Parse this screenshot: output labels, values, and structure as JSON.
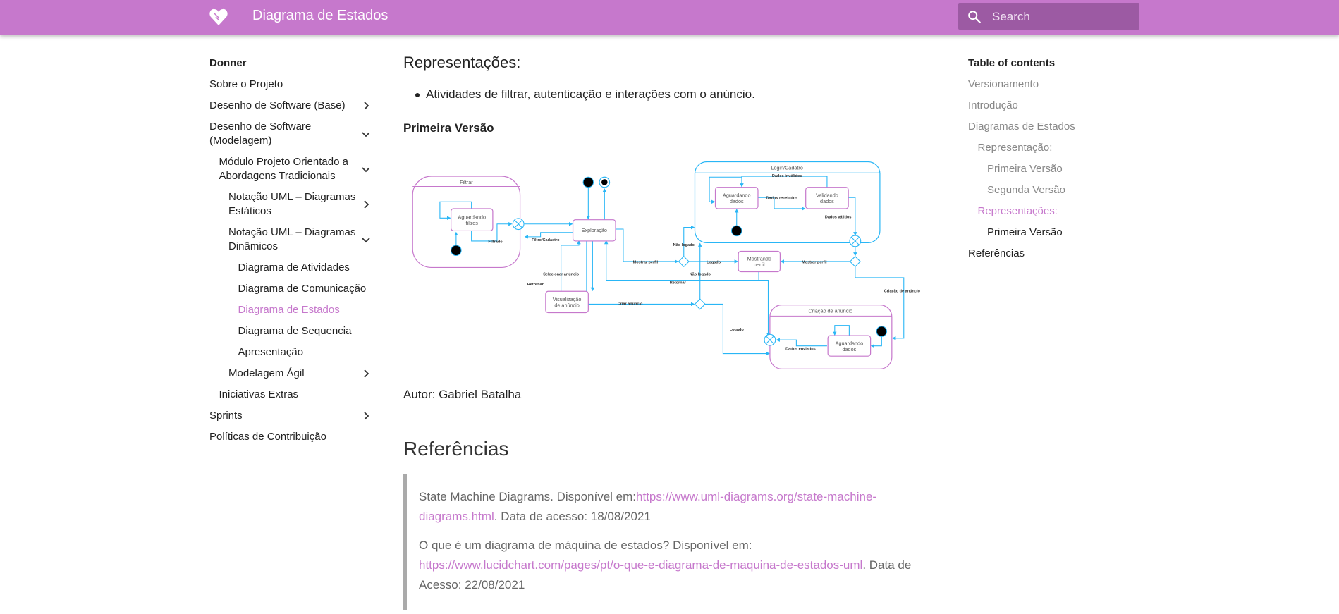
{
  "header": {
    "title": "Diagrama de Estados",
    "search_placeholder": "Search",
    "brand_color": "#c678cc"
  },
  "nav": {
    "items": [
      {
        "label": "Donner",
        "bold": true
      },
      {
        "label": "Sobre o Projeto"
      },
      {
        "label": "Desenho de Software (Base)",
        "chevron": "right"
      },
      {
        "label": "Desenho de Software (Modelagem)",
        "chevron": "down"
      },
      {
        "label": "Módulo Projeto Orientado a Abordagens Tradicionais",
        "chevron": "down"
      },
      {
        "label": "Notação UML – Diagramas Estáticos",
        "chevron": "right"
      },
      {
        "label": "Notação UML – Diagramas Dinâmicos",
        "chevron": "down"
      },
      {
        "label": "Diagrama de Atividades"
      },
      {
        "label": "Diagrama de Comunicação"
      },
      {
        "label": "Diagrama de Estados",
        "active": true
      },
      {
        "label": "Diagrama de Sequencia"
      },
      {
        "label": "Apresentação"
      },
      {
        "label": "Modelagem Ágil",
        "chevron": "right"
      },
      {
        "label": "Iniciativas Extras"
      },
      {
        "label": "Sprints",
        "chevron": "right"
      },
      {
        "label": "Políticas de Contribuição"
      }
    ]
  },
  "content": {
    "heading": "Representações:",
    "bullet": "Atividades de filtrar, autenticação e interações com o anúncio.",
    "subheading": "Primeira Versão",
    "diagram": {
      "filtrar": "Filtrar",
      "aguardando_filtros": [
        "Aguardando",
        "filtros"
      ],
      "filtrado": "Filtrado",
      "filtro_cadastro": "Filtro/Cadastro",
      "exploracao": "Exploração",
      "selecionar": "Selecionar anúncio",
      "retornar": "Retornar",
      "visualizacao": [
        "Visualização",
        "de anúncio"
      ],
      "login": "Login/Cadatro",
      "aguardando_dados": [
        "Aguardando",
        "dados"
      ],
      "validando": [
        "Validando",
        "dados"
      ],
      "dados_invalidos": "Dados inválidos",
      "dados_recebidos": "Dados recebidos",
      "dados_validos": "Dados válidos",
      "nao_logado": "Não logado",
      "logado": "Logado",
      "mostrar_perfil": "Mostrar perfil",
      "mostrando_perfil": [
        "Mostrando",
        "perfil"
      ],
      "criar_anuncio": "Criar anúncio",
      "criacao_anuncio": "Criação de anúncio",
      "dados_enviados": "Dados enviados"
    },
    "author": "Autor: Gabriel Batalha",
    "refs_heading": "Referências",
    "refs": [
      {
        "text": "State Machine Diagrams. Disponível em:",
        "link": "https://www.uml-diagrams.org/state-machine-diagrams.html",
        "after": ". Data de acesso: 18/08/2021"
      },
      {
        "text": "O que é um diagrama de máquina de estados? Disponível em: ",
        "link": "https://www.lucidchart.com/pages/pt/o-que-e-diagrama-de-maquina-de-estados-uml",
        "after": ". Data de Acesso: 22/08/2021"
      }
    ]
  },
  "toc": {
    "title": "Table of contents",
    "items": [
      {
        "label": "Versionamento",
        "level": 0
      },
      {
        "label": "Introdução",
        "level": 0
      },
      {
        "label": "Diagramas de Estados",
        "level": 0
      },
      {
        "label": "Representação:",
        "level": 1
      },
      {
        "label": "Primeira Versão",
        "level": 2
      },
      {
        "label": "Segunda Versão",
        "level": 2
      },
      {
        "label": "Representações:",
        "level": 1,
        "active": true
      },
      {
        "label": "Primeira Versão",
        "level": 2,
        "current": true
      },
      {
        "label": "Referências",
        "level": 0,
        "current": true
      }
    ]
  }
}
